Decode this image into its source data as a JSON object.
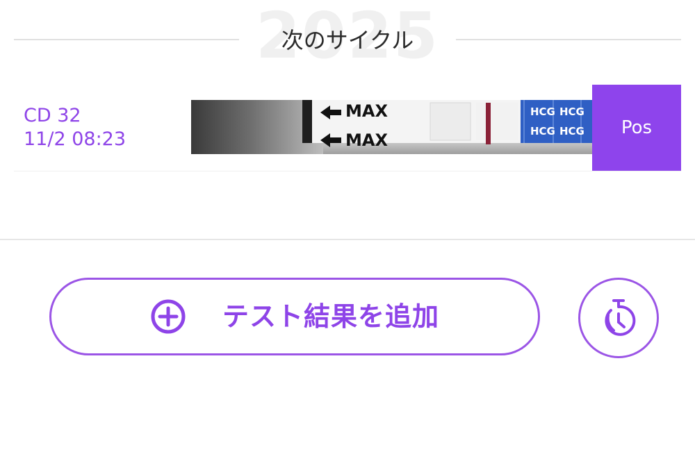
{
  "cycle_header": {
    "year_watermark": "2025",
    "title": "次のサイクル"
  },
  "entry": {
    "cycle_day": "CD 32",
    "datetime": "11/2 08:23",
    "strip_labels": [
      "MAX",
      "MAX",
      "HCG",
      "HCG",
      "HCG",
      "HCG"
    ],
    "result": "Pos"
  },
  "actions": {
    "add_result_label": "テスト結果を追加"
  },
  "icons": {
    "add": "plus-circle-icon",
    "timer": "stopwatch-icon"
  },
  "colors": {
    "accent": "#8e44ec",
    "divider": "#e0e0e0",
    "title_text": "#2b2b2b"
  }
}
